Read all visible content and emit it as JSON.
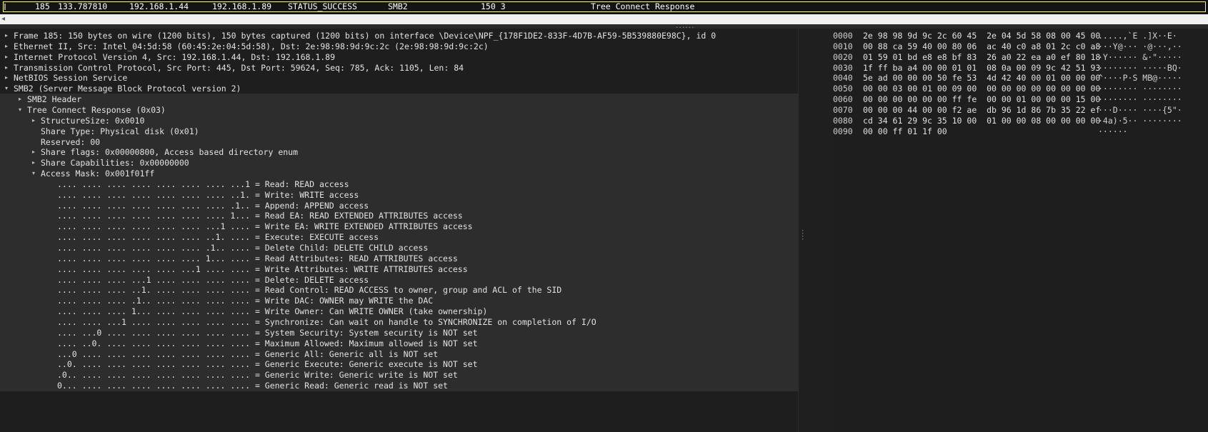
{
  "packet_list": {
    "row": {
      "no": "185",
      "time": "133.787810",
      "source": "192.168.1.44",
      "destination": "192.168.1.89",
      "status": "STATUS_SUCCESS",
      "protocol": "SMB2",
      "length": "150 3",
      "info": "Tree Connect Response"
    }
  },
  "scrollbar": {
    "left_arrow": "◂"
  },
  "splitter": {
    "grip": "......"
  },
  "details": [
    {
      "arrow": "▸",
      "text": "Frame 185: 150 bytes on wire (1200 bits), 150 bytes captured (1200 bits) on interface \\Device\\NPF_{178F1DE2-833F-4D7B-AF59-5B539880E98C}, id 0"
    },
    {
      "arrow": "▸",
      "text": "Ethernet II, Src: Intel_04:5d:58 (60:45:2e:04:5d:58), Dst: 2e:98:98:9d:9c:2c (2e:98:98:9d:9c:2c)"
    },
    {
      "arrow": "▸",
      "text": "Internet Protocol Version 4, Src: 192.168.1.44, Dst: 192.168.1.89"
    },
    {
      "arrow": "▸",
      "text": "Transmission Control Protocol, Src Port: 445, Dst Port: 59624, Seq: 785, Ack: 1105, Len: 84"
    },
    {
      "arrow": "▸",
      "text": "NetBIOS Session Service"
    },
    {
      "arrow": "▾",
      "text": "SMB2 (Server Message Block Protocol version 2)"
    },
    {
      "arrow": "▸",
      "text": "SMB2 Header"
    },
    {
      "arrow": "▾",
      "text": "Tree Connect Response (0x03)"
    },
    {
      "arrow": "▸",
      "text": "StructureSize: 0x0010"
    },
    {
      "arrow": "",
      "text": "Share Type: Physical disk (0x01)"
    },
    {
      "arrow": "",
      "text": "Reserved: 00"
    },
    {
      "arrow": "▸",
      "text": "Share flags: 0x00000800, Access based directory enum"
    },
    {
      "arrow": "▸",
      "text": "Share Capabilities: 0x00000000"
    },
    {
      "arrow": "▾",
      "text": "Access Mask: 0x001f01ff"
    },
    {
      "arrow": "",
      "text": ".... .... .... .... .... .... .... ...1 = Read: READ access"
    },
    {
      "arrow": "",
      "text": ".... .... .... .... .... .... .... ..1. = Write: WRITE access"
    },
    {
      "arrow": "",
      "text": ".... .... .... .... .... .... .... .1.. = Append: APPEND access"
    },
    {
      "arrow": "",
      "text": ".... .... .... .... .... .... .... 1... = Read EA: READ EXTENDED ATTRIBUTES access"
    },
    {
      "arrow": "",
      "text": ".... .... .... .... .... .... ...1 .... = Write EA: WRITE EXTENDED ATTRIBUTES access"
    },
    {
      "arrow": "",
      "text": ".... .... .... .... .... .... ..1. .... = Execute: EXECUTE access"
    },
    {
      "arrow": "",
      "text": ".... .... .... .... .... .... .1.. .... = Delete Child: DELETE CHILD access"
    },
    {
      "arrow": "",
      "text": ".... .... .... .... .... .... 1... .... = Read Attributes: READ ATTRIBUTES access"
    },
    {
      "arrow": "",
      "text": ".... .... .... .... .... ...1 .... .... = Write Attributes: WRITE ATTRIBUTES access"
    },
    {
      "arrow": "",
      "text": ".... .... .... ...1 .... .... .... .... = Delete: DELETE access"
    },
    {
      "arrow": "",
      "text": ".... .... .... ..1. .... .... .... .... = Read Control: READ ACCESS to owner, group and ACL of the SID"
    },
    {
      "arrow": "",
      "text": ".... .... .... .1.. .... .... .... .... = Write DAC: OWNER may WRITE the DAC"
    },
    {
      "arrow": "",
      "text": ".... .... .... 1... .... .... .... .... = Write Owner: Can WRITE OWNER (take ownership)"
    },
    {
      "arrow": "",
      "text": ".... .... ...1 .... .... .... .... .... = Synchronize: Can wait on handle to SYNCHRONIZE on completion of I/O"
    },
    {
      "arrow": "",
      "text": ".... ...0 .... .... .... .... .... .... = System Security: System security is NOT set"
    },
    {
      "arrow": "",
      "text": ".... ..0. .... .... .... .... .... .... = Maximum Allowed: Maximum allowed is NOT set"
    },
    {
      "arrow": "",
      "text": "...0 .... .... .... .... .... .... .... = Generic All: Generic all is NOT set"
    },
    {
      "arrow": "",
      "text": "..0. .... .... .... .... .... .... .... = Generic Execute: Generic execute is NOT set"
    },
    {
      "arrow": "",
      "text": ".0.. .... .... .... .... .... .... .... = Generic Write: Generic write is NOT set"
    },
    {
      "arrow": "",
      "text": "0... .... .... .... .... .... .... .... = Generic Read: Generic read is NOT set"
    }
  ],
  "hex_dump": [
    {
      "offset": "0000",
      "bytes": "2e 98 98 9d 9c 2c 60 45  2e 04 5d 58 08 00 45 00",
      "ascii": ".....,`E .]X··E·"
    },
    {
      "offset": "0010",
      "bytes": "00 88 ca 59 40 00 80 06  ac 40 c0 a8 01 2c c0 a8",
      "ascii": "···Y@··· ·@···,··"
    },
    {
      "offset": "0020",
      "bytes": "01 59 01 bd e8 e8 bf 83  26 a0 22 ea a0 ef 80 18",
      "ascii": "·Y······ &·\"·····"
    },
    {
      "offset": "0030",
      "bytes": "1f ff ba a4 00 00 01 01  08 0a 00 09 9c 42 51 93",
      "ascii": "········ ·····BQ·"
    },
    {
      "offset": "0040",
      "bytes": "5e ad 00 00 00 50 fe 53  4d 42 40 00 01 00 00 00",
      "ascii": "^····P·S MB@·····"
    },
    {
      "offset": "0050",
      "bytes": "00 00 03 00 01 00 09 00  00 00 00 00 00 00 00 00",
      "ascii": "········ ········"
    },
    {
      "offset": "0060",
      "bytes": "00 00 00 00 00 00 ff fe  00 00 01 00 00 00 15 00",
      "ascii": "········ ········"
    },
    {
      "offset": "0070",
      "bytes": "00 00 00 44 00 00 f2 ae  db 96 1d 86 7b 35 22 ef",
      "ascii": "···D···· ····{5\"·"
    },
    {
      "offset": "0080",
      "bytes": "cd 34 61 29 9c 35 10 00  01 00 00 08 00 00 00 00",
      "ascii": "·4a)·5·· ········"
    },
    {
      "offset": "0090",
      "bytes": "00 00 ff 01 1f 00",
      "ascii": "······"
    }
  ]
}
